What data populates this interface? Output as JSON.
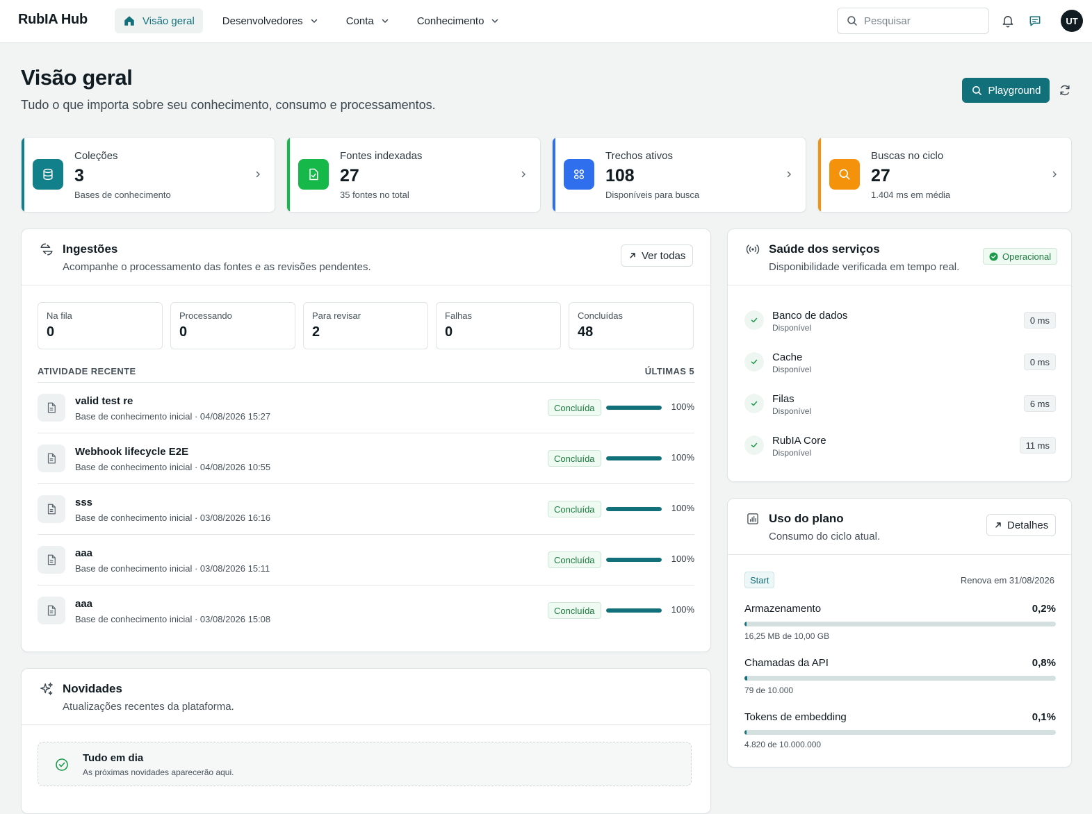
{
  "brand": "RubIA Hub",
  "nav": {
    "overview": "Visão geral",
    "developers": "Desenvolvedores",
    "account": "Conta",
    "knowledge": "Conhecimento"
  },
  "search": {
    "placeholder": "Pesquisar"
  },
  "user": {
    "initials": "UT"
  },
  "header": {
    "title": "Visão geral",
    "subtitle": "Tudo o que importa sobre seu conhecimento, consumo e processamentos.",
    "playground_label": "Playground"
  },
  "stats": [
    {
      "label": "Coleções",
      "value": "3",
      "sub": "Bases de conhecimento",
      "color": "#12808a",
      "icon": "database-icon"
    },
    {
      "label": "Fontes indexadas",
      "value": "27",
      "sub": "35 fontes no total",
      "color": "#16b84a",
      "icon": "file-check-icon"
    },
    {
      "label": "Trechos ativos",
      "value": "108",
      "sub": "Disponíveis para busca",
      "color": "#2f6fee",
      "icon": "grid-icon"
    },
    {
      "label": "Buscas no ciclo",
      "value": "27",
      "sub": "1.404 ms em média",
      "color": "#f5920b",
      "icon": "search-icon"
    }
  ],
  "ingestions": {
    "title": "Ingestões",
    "subtitle": "Acompanhe o processamento das fontes e as revisões pendentes.",
    "view_all": "Ver todas",
    "counters": [
      {
        "label": "Na fila",
        "value": "0"
      },
      {
        "label": "Processando",
        "value": "0"
      },
      {
        "label": "Para revisar",
        "value": "2"
      },
      {
        "label": "Falhas",
        "value": "0"
      },
      {
        "label": "Concluídas",
        "value": "48"
      }
    ],
    "activity_label": "ATIVIDADE RECENTE",
    "activity_range": "ÚLTIMAS 5",
    "items": [
      {
        "name": "valid test re",
        "meta": "Base de conhecimento inicial · 04/08/2026 15:27",
        "status": "Concluída",
        "progress": 100,
        "percent": "100%"
      },
      {
        "name": "Webhook lifecycle E2E",
        "meta": "Base de conhecimento inicial · 04/08/2026 10:55",
        "status": "Concluída",
        "progress": 100,
        "percent": "100%"
      },
      {
        "name": "sss",
        "meta": "Base de conhecimento inicial · 03/08/2026 16:16",
        "status": "Concluída",
        "progress": 100,
        "percent": "100%"
      },
      {
        "name": "aaa",
        "meta": "Base de conhecimento inicial · 03/08/2026 15:11",
        "status": "Concluída",
        "progress": 100,
        "percent": "100%"
      },
      {
        "name": "aaa",
        "meta": "Base de conhecimento inicial · 03/08/2026 15:08",
        "status": "Concluída",
        "progress": 100,
        "percent": "100%"
      }
    ]
  },
  "news": {
    "title": "Novidades",
    "subtitle": "Atualizações recentes da plataforma.",
    "empty_title": "Tudo em dia",
    "empty_sub": "As próximas novidades aparecerão aqui."
  },
  "health": {
    "title": "Saúde dos serviços",
    "subtitle": "Disponibilidade verificada em tempo real.",
    "status": "Operacional",
    "services": [
      {
        "name": "Banco de dados",
        "status": "Disponível",
        "latency": "0 ms"
      },
      {
        "name": "Cache",
        "status": "Disponível",
        "latency": "0 ms"
      },
      {
        "name": "Filas",
        "status": "Disponível",
        "latency": "6 ms"
      },
      {
        "name": "RubIA Core",
        "status": "Disponível",
        "latency": "11 ms"
      }
    ]
  },
  "plan": {
    "title": "Uso do plano",
    "subtitle": "Consumo do ciclo atual.",
    "details_label": "Detalhes",
    "tier": "Start",
    "renewal": "Renova em 31/08/2026",
    "usage": [
      {
        "label": "Armazenamento",
        "percent": "0,2%",
        "fraction": 0.002,
        "detail": "16,25 MB de 10,00 GB"
      },
      {
        "label": "Chamadas da API",
        "percent": "0,8%",
        "fraction": 0.008,
        "detail": "79 de 10.000"
      },
      {
        "label": "Tokens de embedding",
        "percent": "0,1%",
        "fraction": 0.001,
        "detail": "4.820 de 10.000.000"
      }
    ]
  },
  "colors": {
    "accent": "#12707a",
    "success": "#1b7a3d"
  }
}
